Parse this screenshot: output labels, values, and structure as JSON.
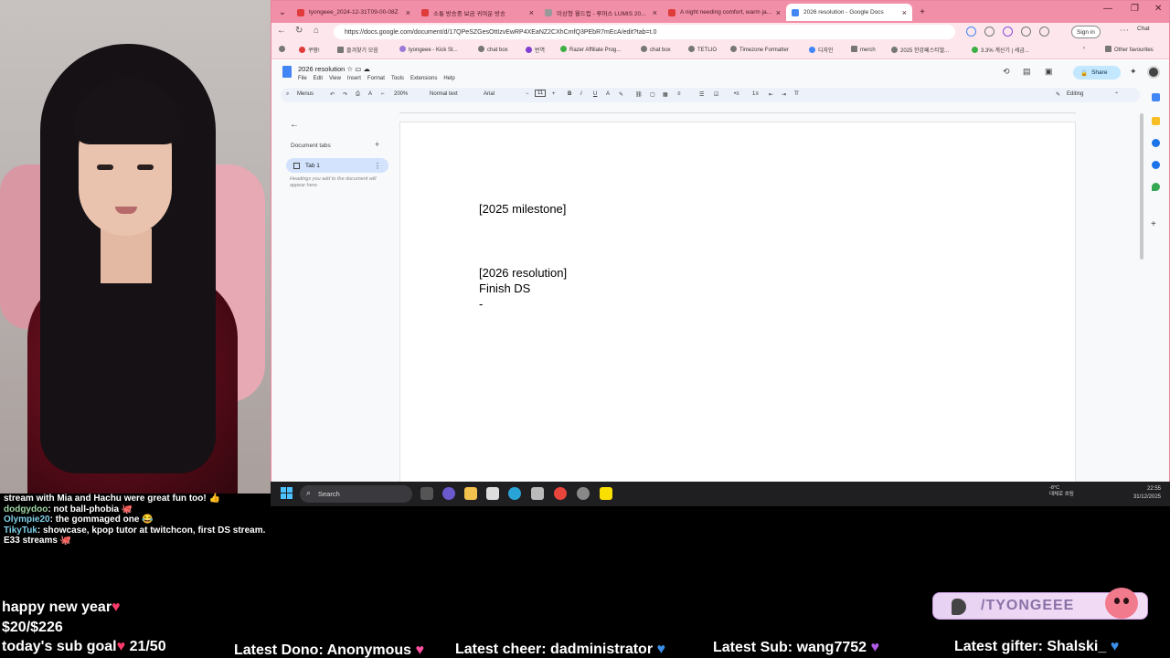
{
  "browser": {
    "tabs": [
      {
        "label": "tyongeee_2024-12-31T09-00-08Z",
        "active": false
      },
      {
        "label": "소통 방송중 보금 귀여운 방송",
        "active": false
      },
      {
        "label": "이상형 월드컵 - 루머스 LUMIS 20...",
        "active": false
      },
      {
        "label": "A night needing comfort, warm ja...",
        "active": false
      },
      {
        "label": "2026 resolution - Google Docs",
        "active": true
      }
    ],
    "new_tab": "+",
    "url": "https://docs.google.com/document/d/17QPeSZGesOttIzvEwRP4XEaNZ2CXhCmfQ3PEbR7mEcA/edit?tab=t.0",
    "sign_in": "Sign in",
    "chat": "Chat",
    "bookmarks": [
      "쿠팡!",
      "즐겨찾기 모음",
      "tyongeee - Kick St...",
      "chat box",
      "번역",
      "Razer Affiliate Prog...",
      "chat box",
      "TETLIO",
      "Timezone Formatter",
      "디자인",
      "merch",
      "2025 한강페스티벌...",
      "3.3% 계산기 | 세금...",
      "Other favourites"
    ]
  },
  "docs": {
    "title": "2026 resolution",
    "menu": [
      "File",
      "Edit",
      "View",
      "Insert",
      "Format",
      "Tools",
      "Extensions",
      "Help"
    ],
    "share": "Share",
    "avatar": "•",
    "toolbar": {
      "menus": "Menus",
      "zoom": "200%",
      "style": "Normal text",
      "font": "Arial",
      "font_size": "11",
      "mode": "Editing"
    },
    "side_panel": {
      "title": "Document tabs",
      "tab_name": "Tab 1",
      "hint": "Headings you add to the document will appear here."
    },
    "lines": [
      "[2025 milestone]",
      "[2026 resolution]",
      "Finish DS",
      "-"
    ]
  },
  "taskbar": {
    "search": "Search",
    "weather_temp": "-8°C",
    "weather_desc": "대체로 흐림",
    "time": "22:55",
    "date": "31/12/2025"
  },
  "chat": [
    {
      "user": "",
      "text": "stream with Mia and Hachu were great fun too! 👍"
    },
    {
      "user": "dodgydoo",
      "text": ": not ball-phobia 🐙"
    },
    {
      "user": "Olympie20",
      "text": ": the gommaged one 😂"
    },
    {
      "user": "TikyTuk",
      "text": ": showcase, kpop tutor at twitchcon, first DS stream. E33 streams 🐙"
    }
  ],
  "overlay": {
    "greeting": "happy new year",
    "progress": "$20/$226",
    "sub_goal_label": "today's sub goal",
    "sub_goal_count": "21/50",
    "latest_dono": "Latest Dono: Anonymous",
    "latest_cheer": "Latest cheer: dadministrator",
    "latest_sub": "Latest Sub: wang7752",
    "latest_gifter": "Latest gifter: Shalski_",
    "channel_tag": "/TYONGEEE"
  }
}
